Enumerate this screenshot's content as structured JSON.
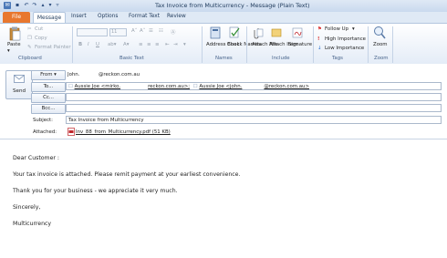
{
  "window": {
    "title": "Tax Invoice from Multicurrency - Message (Plain Text)"
  },
  "tabs": [
    "File",
    "Message",
    "Insert",
    "Options",
    "Format Text",
    "Review"
  ],
  "ribbon": {
    "clipboard": {
      "paste": "Paste",
      "cut": "Cut",
      "copy": "Copy",
      "format_painter": "Format Painter",
      "label": "Clipboard"
    },
    "basic_text": {
      "font_size": "11",
      "label": "Basic Text"
    },
    "names": {
      "address_book": "Address Book",
      "check_names": "Check Names",
      "label": "Names"
    },
    "include": {
      "attach_file": "Attach File",
      "attach_item": "Attach Item",
      "signature": "Signature",
      "label": "Include"
    },
    "tags": {
      "follow_up": "Follow Up",
      "high_importance": "High Importance",
      "low_importance": "Low Importance",
      "label": "Tags"
    },
    "zoom": {
      "zoom": "Zoom",
      "label": "Zoom"
    }
  },
  "header": {
    "send": "Send",
    "from_label": "From",
    "from_value_prefix": "John.",
    "from_value_suffix": "@reckon.com.au",
    "to_label": "To...",
    "to_recipient_1_a": "Aussie Joe <mirko.",
    "to_recipient_1_b": "reckon.com.au>;",
    "to_recipient_2_a": "Aussie Joe <john.",
    "to_recipient_2_b": "@reckon.com.au>",
    "cc_label": "Cc...",
    "bcc_label": "Bcc...",
    "subject_label": "Subject:",
    "subject_value": "Tax Invoice from Multicurrency",
    "attached_label": "Attached:",
    "attachment": "Inv_88_from_Multicurrency.pdf (51 KB)"
  },
  "body": {
    "lines": [
      "Dear Customer :",
      "Your tax invoice is attached.  Please remit payment at your earliest convenience.",
      "Thank you for your business - we appreciate it very much.",
      "Sincerely,",
      "Multicurrency"
    ]
  },
  "colors": {
    "file_tab": "#e8772e",
    "ribbon_blue": "#dfe9f5",
    "accent": "#1e395b",
    "pdf_red": "#c0272d"
  }
}
